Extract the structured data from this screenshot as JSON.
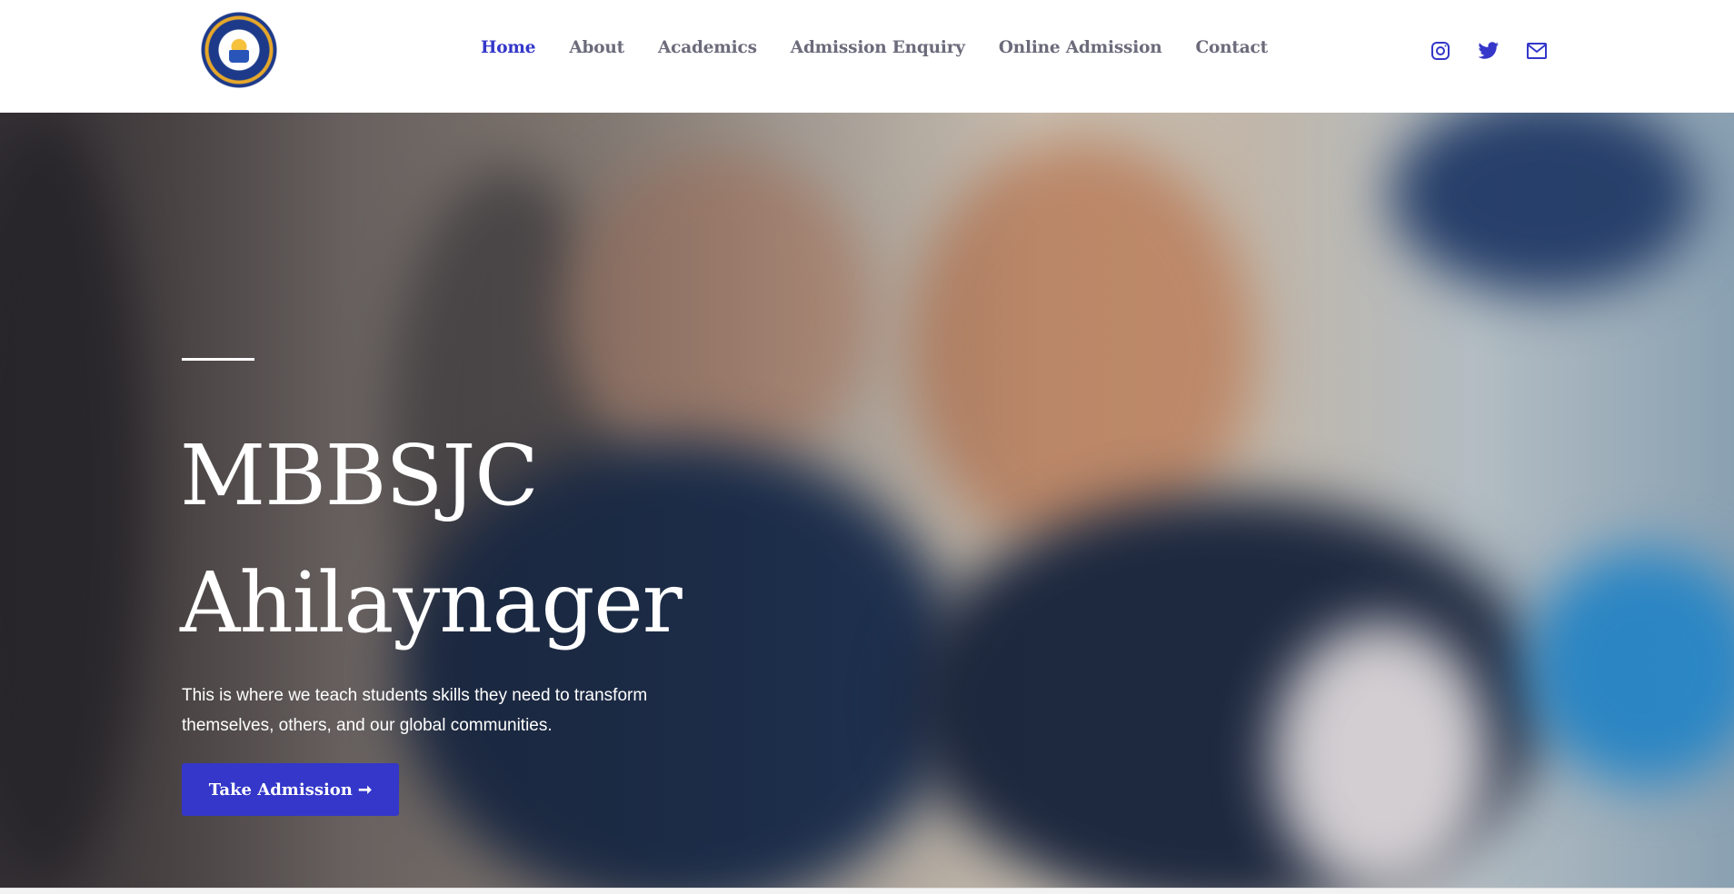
{
  "header": {
    "logo_name": "school-logo",
    "nav": [
      {
        "label": "Home",
        "active": true
      },
      {
        "label": "About",
        "active": false
      },
      {
        "label": "Academics",
        "active": false
      },
      {
        "label": "Admission Enquiry",
        "active": false
      },
      {
        "label": "Online Admission",
        "active": false
      },
      {
        "label": "Contact",
        "active": false
      }
    ],
    "social_icons": [
      "instagram-icon",
      "twitter-icon",
      "mail-icon"
    ]
  },
  "hero": {
    "title_line1": "MBBSJC",
    "title_line2": "Ahilaynager",
    "description_line1": "This is where we teach students skills they need to transform",
    "description_line2": "themselves, others, and our global communities.",
    "cta_label": "Take Admission ➞"
  },
  "colors": {
    "accent": "#3437c9",
    "nav_text": "#6b6b7b",
    "hero_text": "#ffffff"
  }
}
